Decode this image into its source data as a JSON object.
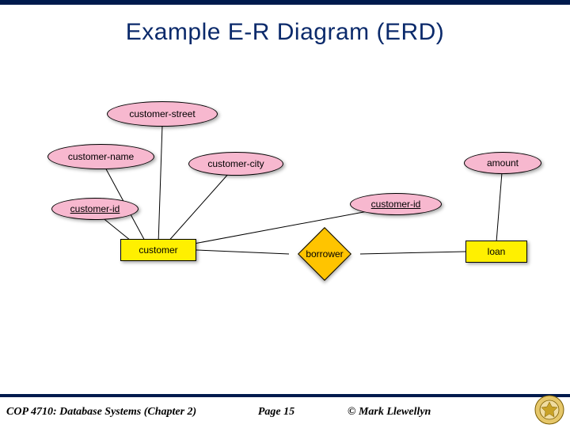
{
  "title": "Example E-R Diagram (ERD)",
  "attributes": {
    "customer_street": "customer-street",
    "customer_name": "customer-name",
    "customer_city": "customer-city",
    "customer_id_right": "customer-id",
    "customer_id_left": "customer-id",
    "amount": "amount"
  },
  "entities": {
    "customer": "customer",
    "loan": "loan"
  },
  "relationship": {
    "borrower": "borrower"
  },
  "footer": {
    "course": "COP 4710: Database Systems  (Chapter 2)",
    "page": "Page 15",
    "author": "© Mark Llewellyn"
  },
  "chart_data": {
    "type": "er-diagram",
    "entities": [
      {
        "name": "customer",
        "attributes": [
          "customer-street",
          "customer-name",
          "customer-city",
          "customer-id",
          "customer-id"
        ]
      },
      {
        "name": "loan",
        "attributes": [
          "amount"
        ]
      }
    ],
    "relationships": [
      {
        "name": "borrower",
        "between": [
          "customer",
          "loan"
        ]
      }
    ],
    "underlined_keys": [
      "customer-id"
    ],
    "title": "Example E-R Diagram (ERD)"
  }
}
